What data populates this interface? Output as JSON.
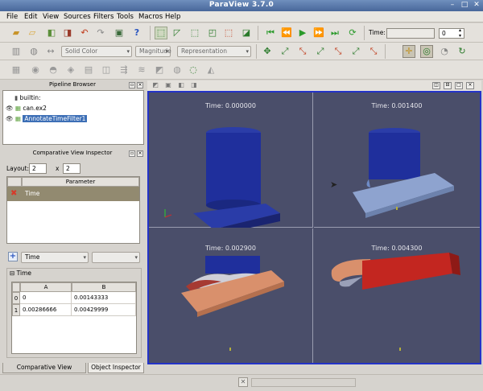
{
  "window": {
    "title": "ParaView 3.7.0",
    "minimize": "–",
    "maximize": "□",
    "close": "✕"
  },
  "menu": [
    "File",
    "Edit",
    "View",
    "Sources",
    "Filters",
    "Tools",
    "Macros",
    "Help"
  ],
  "toolbar1": {
    "time_label": "Time:",
    "time_value": "0",
    "icons": [
      "open-icon",
      "open-folder-icon",
      "connect-icon",
      "disconnect-icon",
      "undo-icon",
      "redo-icon",
      "camera-icon",
      "help-icon",
      "select-cells-icon",
      "select-points-icon",
      "select-frustum-icon",
      "select-block-icon",
      "interactive-select-icon",
      "pick-icon",
      "first-frame-icon",
      "previous-frame-icon",
      "play-icon",
      "next-frame-icon",
      "last-frame-icon",
      "loop-icon"
    ]
  },
  "toolbar2": {
    "color_by": "Solid Color",
    "component": "Magnitude",
    "representation": "Representation",
    "icons": [
      "rescale-icon",
      "reset-camera-icon",
      "view-x-plus-icon",
      "view-x-minus-icon",
      "view-y-plus-icon",
      "view-y-minus-icon",
      "view-z-plus-icon",
      "view-z-minus-icon",
      "center-axes-icon",
      "pick-center-icon",
      "rotate-icon"
    ]
  },
  "pipeline_browser": {
    "title": "Pipeline Browser",
    "items": [
      {
        "label": "builtin:",
        "selected": false
      },
      {
        "label": "can.ex2",
        "selected": false
      },
      {
        "label": "AnnotateTimeFilter1",
        "selected": true
      }
    ]
  },
  "comparative_inspector": {
    "title": "Comparative View Inspector",
    "layout_label": "Layout:",
    "layout_x": "2",
    "layout_y": "2",
    "times_sign": "x",
    "param_header": "Parameter",
    "param_row": "Time",
    "add_combo": "Time",
    "group_title": "Time",
    "table": {
      "columns": [
        "A",
        "B"
      ],
      "rows": [
        {
          "index": "0",
          "cells": [
            "0",
            "0.00143333"
          ]
        },
        {
          "index": "1",
          "cells": [
            "0.00286666",
            "0.00429999"
          ]
        }
      ]
    }
  },
  "tabs": [
    "Comparative View Inspec...",
    "Object Inspector"
  ],
  "views": [
    {
      "time": "Time: 0.000000"
    },
    {
      "time": "Time: 0.001400"
    },
    {
      "time": "Time: 0.002900"
    },
    {
      "time": "Time: 0.004300"
    }
  ],
  "colors": {
    "accent_frame": "#2433c8",
    "background": "#4a4e6a",
    "can_blue": "#1f2f9c",
    "plate_red": "#c32620",
    "plate_salmon": "#d9906c",
    "plate_lightblue": "#8ea3cf"
  }
}
